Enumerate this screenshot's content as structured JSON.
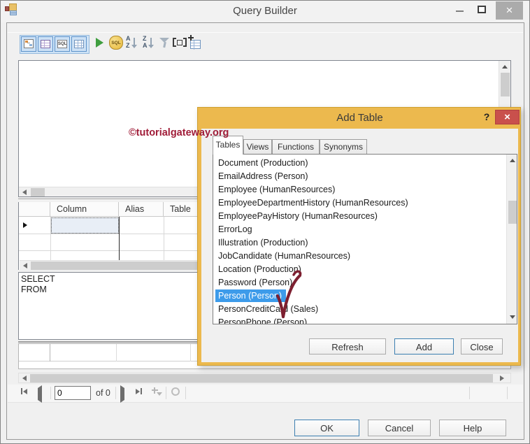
{
  "window": {
    "title": "Query Builder",
    "close_glyph": "×"
  },
  "toolbar": {
    "sql_pane_glyph": "SQL",
    "sql_db_glyph": "SQL",
    "sort_ascending": {
      "top": "A",
      "bottom": "Z"
    },
    "sort_descending": {
      "top": "Z",
      "bottom": "A"
    }
  },
  "grid_pane": {
    "headers": [
      "Column",
      "Alias",
      "Table"
    ]
  },
  "sql_pane": {
    "lines": [
      "SELECT",
      "FROM"
    ]
  },
  "navigator": {
    "position": "0",
    "count_label": "of 0"
  },
  "footer_buttons": {
    "ok": "OK",
    "cancel": "Cancel",
    "help": "Help"
  },
  "dialog": {
    "title": "Add Table",
    "help_glyph": "?",
    "close_glyph": "×",
    "tabs": [
      {
        "label": "Tables",
        "active": true
      },
      {
        "label": "Views",
        "active": false
      },
      {
        "label": "Functions",
        "active": false
      },
      {
        "label": "Synonyms",
        "active": false
      }
    ],
    "list": {
      "items": [
        "Document (Production)",
        "EmailAddress (Person)",
        "Employee (HumanResources)",
        "EmployeeDepartmentHistory (HumanResources)",
        "EmployeePayHistory (HumanResources)",
        "ErrorLog",
        "Illustration (Production)",
        "JobCandidate (HumanResources)",
        "Location (Production)",
        "Password (Person)",
        "Person (Person)",
        "PersonCreditCard (Sales)",
        "PersonPhone (Person)"
      ],
      "selected_index": 10,
      "selected_item": "Person (Person)"
    },
    "buttons": {
      "refresh": "Refresh",
      "add": "Add",
      "close": "Close"
    }
  },
  "watermark": {
    "text": "©tutorialgateway.org",
    "color": "#A01C38"
  },
  "annotation": {
    "type": "checkmark",
    "color": "#7D1F30"
  },
  "colors": {
    "dialog_frame": "#ECB94E",
    "selection_blue": "#3D9BEA",
    "dialog_close_red": "#C9504C",
    "default_button_border": "#3C7FB1"
  }
}
